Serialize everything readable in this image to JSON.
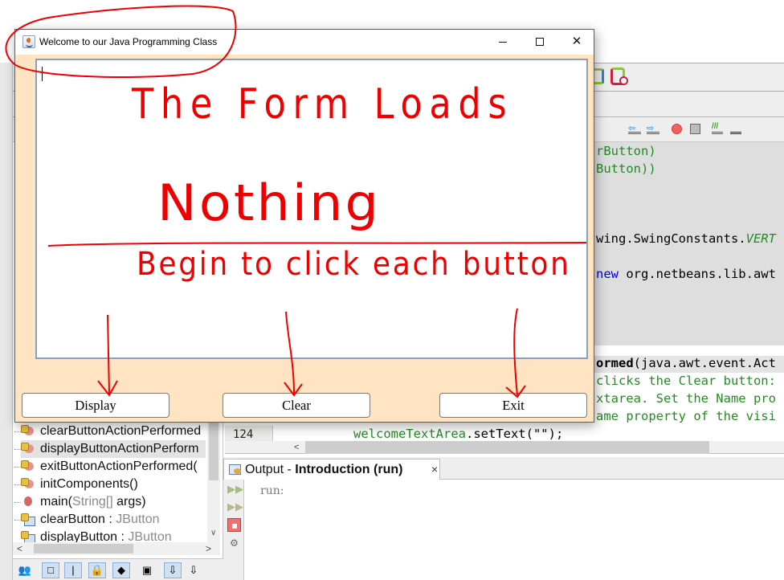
{
  "window": {
    "title": "Welcome to our Java Programming Class",
    "controls": {
      "minimize": "minimize",
      "maximize": "maximize",
      "close": "✕"
    },
    "textarea_value": "",
    "buttons": {
      "display": "Display",
      "clear": "Clear",
      "exit": "Exit"
    },
    "background_color": "#ffe4c4"
  },
  "annotations": {
    "line1": "The Form Loads",
    "line2": "Nothing",
    "line3": "Begin to click each button",
    "ink_color": "#ee0000"
  },
  "editor": {
    "lines": [
      {
        "text": "rButton)"
      },
      {
        "text": "Button))"
      },
      {
        "pre": "wing.SwingConstants.",
        "ital": "VERT"
      },
      {
        "kw": "new",
        "rest": " org.netbeans.lib.awt"
      },
      {
        "bold": "ormed",
        "rest": "(java.awt.event.Act"
      },
      {
        "text": "clicks the Clear button:"
      },
      {
        "text": "xtarea. Set the Name pro"
      },
      {
        "text": "ame property of the visi"
      }
    ],
    "visible_line_number": "124",
    "visible_line_code": "welcomeTextArea",
    "visible_line_code_rest": ".setText(\"\");"
  },
  "navigator": {
    "items": [
      {
        "label": "clearButtonActionPerformed",
        "type": "",
        "icon": "method-icon"
      },
      {
        "label": "displayButtonActionPerform",
        "type": "",
        "icon": "method-icon",
        "selected": true
      },
      {
        "label": "exitButtonActionPerformed(",
        "type": "",
        "icon": "method-icon"
      },
      {
        "label": "initComponents()",
        "type": "",
        "icon": "method-icon"
      },
      {
        "label": "main(",
        "type": "String[]",
        "label2": " args)",
        "icon": "main-icon"
      },
      {
        "label": "clearButton : ",
        "type": "JButton",
        "icon": "field-icon"
      },
      {
        "label": "displayButton : ",
        "type": "JButton",
        "icon": "field-icon"
      }
    ]
  },
  "output": {
    "tab_prefix": "Output - ",
    "tab_title": "Introduction (run)",
    "close": "×",
    "text": "run:"
  }
}
